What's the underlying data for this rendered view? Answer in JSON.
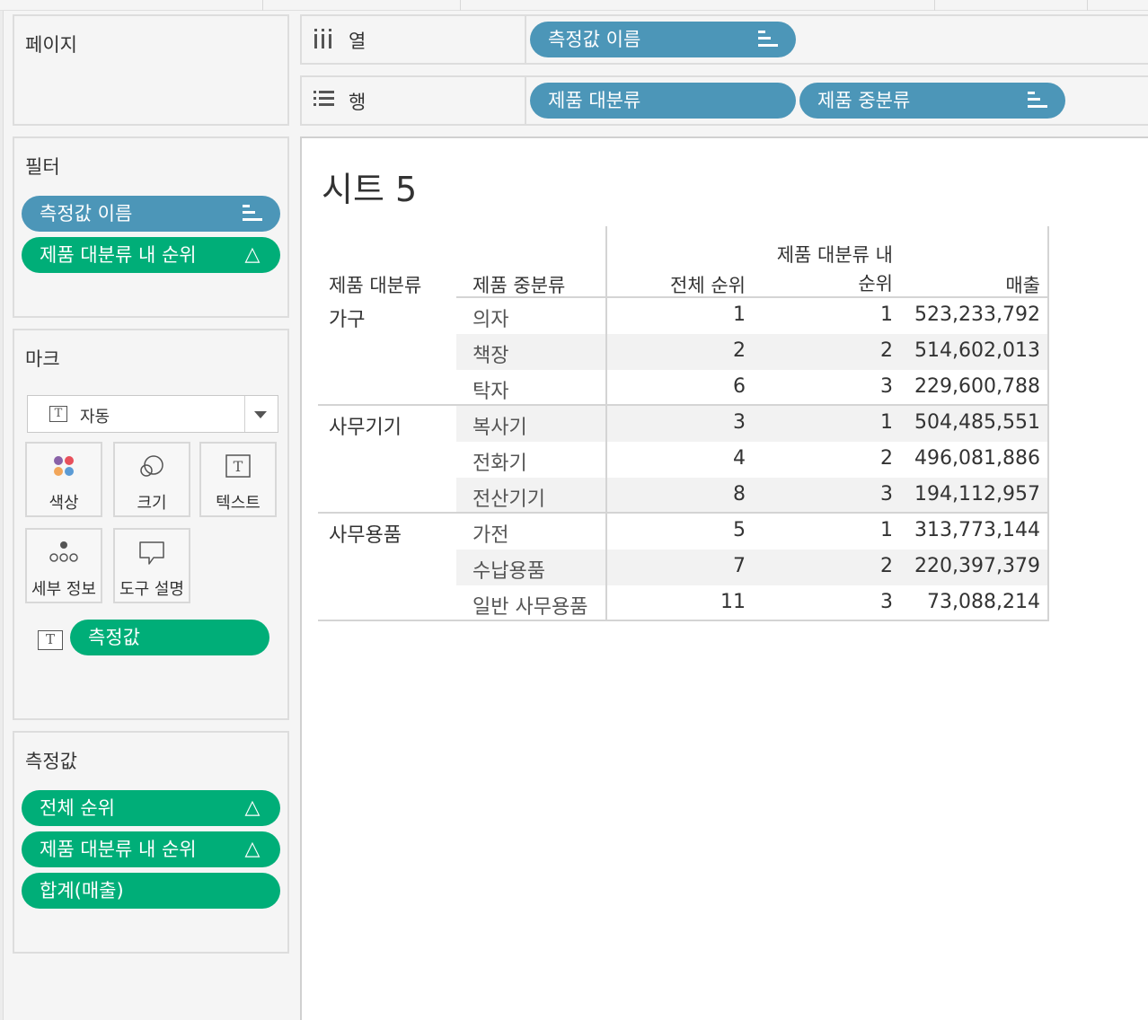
{
  "pages_card": {
    "title": "페이지"
  },
  "shelves": {
    "columns": {
      "label": "열",
      "pills": [
        {
          "label": "측정값 이름"
        }
      ]
    },
    "rows": {
      "label": "행",
      "pills": [
        {
          "label": "제품 대분류"
        },
        {
          "label": "제품 중분류"
        }
      ]
    }
  },
  "filters_card": {
    "title": "필터",
    "pills": [
      {
        "label": "측정값 이름",
        "color": "#4c96b8"
      },
      {
        "label": "제품 대분류 내 순위",
        "color": "#00ae78"
      }
    ]
  },
  "marks_card": {
    "title": "마크",
    "mark_type": "자동",
    "buttons": [
      {
        "label": "색상"
      },
      {
        "label": "크기"
      },
      {
        "label": "텍스트"
      },
      {
        "label": "세부 정보"
      },
      {
        "label": "도구 설명"
      }
    ],
    "text_pill": "측정값",
    "text_pill_icon_glyph": "T"
  },
  "measures_card": {
    "title": "측정값",
    "pills": [
      {
        "label": "전체 순위"
      },
      {
        "label": "제품 대분류 내 순위"
      },
      {
        "label": "합계(매출)"
      }
    ]
  },
  "icons": {
    "delta_glyph": "△",
    "t_glyph": "T"
  },
  "view": {
    "sheet_title": "시트 5",
    "headers": {
      "category": "제품 대분류",
      "subcategory": "제품 중분류",
      "overall_rank": "전체 순위",
      "rank_within_line1": "제품 대분류 내",
      "rank_within_line2": "순위",
      "sales": "매출"
    },
    "groups": [
      {
        "category": "가구",
        "rows": [
          {
            "subcategory": "의자",
            "overall_rank": "1",
            "rank_within": "1",
            "sales": "523,233,792"
          },
          {
            "subcategory": "책장",
            "overall_rank": "2",
            "rank_within": "2",
            "sales": "514,602,013"
          },
          {
            "subcategory": "탁자",
            "overall_rank": "6",
            "rank_within": "3",
            "sales": "229,600,788"
          }
        ]
      },
      {
        "category": "사무기기",
        "rows": [
          {
            "subcategory": "복사기",
            "overall_rank": "3",
            "rank_within": "1",
            "sales": "504,485,551"
          },
          {
            "subcategory": "전화기",
            "overall_rank": "4",
            "rank_within": "2",
            "sales": "496,081,886"
          },
          {
            "subcategory": "전산기기",
            "overall_rank": "8",
            "rank_within": "3",
            "sales": "194,112,957"
          }
        ]
      },
      {
        "category": "사무용품",
        "rows": [
          {
            "subcategory": "가전",
            "overall_rank": "5",
            "rank_within": "1",
            "sales": "313,773,144"
          },
          {
            "subcategory": "수납용품",
            "overall_rank": "7",
            "rank_within": "2",
            "sales": "220,397,379"
          },
          {
            "subcategory": "일반 사무용품",
            "overall_rank": "11",
            "rank_within": "3",
            "sales": "73,088,214"
          }
        ]
      }
    ]
  }
}
